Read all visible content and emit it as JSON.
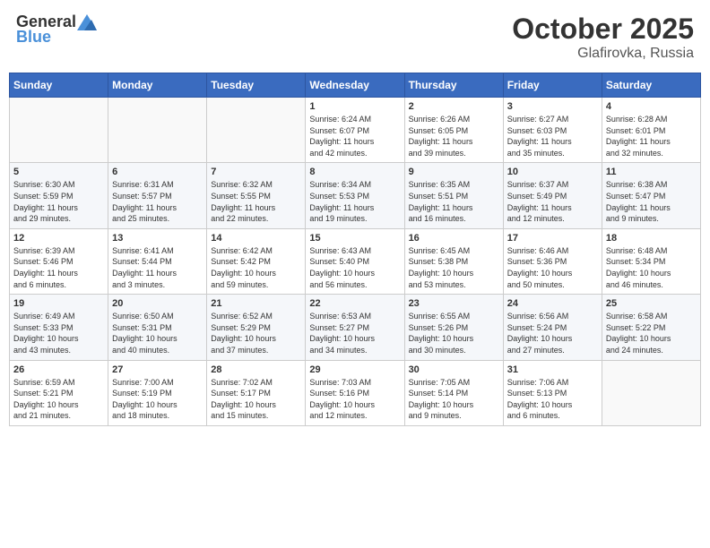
{
  "header": {
    "logo_general": "General",
    "logo_blue": "Blue",
    "month": "October 2025",
    "location": "Glafirovka, Russia"
  },
  "weekdays": [
    "Sunday",
    "Monday",
    "Tuesday",
    "Wednesday",
    "Thursday",
    "Friday",
    "Saturday"
  ],
  "weeks": [
    [
      {
        "day": "",
        "info": ""
      },
      {
        "day": "",
        "info": ""
      },
      {
        "day": "",
        "info": ""
      },
      {
        "day": "1",
        "info": "Sunrise: 6:24 AM\nSunset: 6:07 PM\nDaylight: 11 hours\nand 42 minutes."
      },
      {
        "day": "2",
        "info": "Sunrise: 6:26 AM\nSunset: 6:05 PM\nDaylight: 11 hours\nand 39 minutes."
      },
      {
        "day": "3",
        "info": "Sunrise: 6:27 AM\nSunset: 6:03 PM\nDaylight: 11 hours\nand 35 minutes."
      },
      {
        "day": "4",
        "info": "Sunrise: 6:28 AM\nSunset: 6:01 PM\nDaylight: 11 hours\nand 32 minutes."
      }
    ],
    [
      {
        "day": "5",
        "info": "Sunrise: 6:30 AM\nSunset: 5:59 PM\nDaylight: 11 hours\nand 29 minutes."
      },
      {
        "day": "6",
        "info": "Sunrise: 6:31 AM\nSunset: 5:57 PM\nDaylight: 11 hours\nand 25 minutes."
      },
      {
        "day": "7",
        "info": "Sunrise: 6:32 AM\nSunset: 5:55 PM\nDaylight: 11 hours\nand 22 minutes."
      },
      {
        "day": "8",
        "info": "Sunrise: 6:34 AM\nSunset: 5:53 PM\nDaylight: 11 hours\nand 19 minutes."
      },
      {
        "day": "9",
        "info": "Sunrise: 6:35 AM\nSunset: 5:51 PM\nDaylight: 11 hours\nand 16 minutes."
      },
      {
        "day": "10",
        "info": "Sunrise: 6:37 AM\nSunset: 5:49 PM\nDaylight: 11 hours\nand 12 minutes."
      },
      {
        "day": "11",
        "info": "Sunrise: 6:38 AM\nSunset: 5:47 PM\nDaylight: 11 hours\nand 9 minutes."
      }
    ],
    [
      {
        "day": "12",
        "info": "Sunrise: 6:39 AM\nSunset: 5:46 PM\nDaylight: 11 hours\nand 6 minutes."
      },
      {
        "day": "13",
        "info": "Sunrise: 6:41 AM\nSunset: 5:44 PM\nDaylight: 11 hours\nand 3 minutes."
      },
      {
        "day": "14",
        "info": "Sunrise: 6:42 AM\nSunset: 5:42 PM\nDaylight: 10 hours\nand 59 minutes."
      },
      {
        "day": "15",
        "info": "Sunrise: 6:43 AM\nSunset: 5:40 PM\nDaylight: 10 hours\nand 56 minutes."
      },
      {
        "day": "16",
        "info": "Sunrise: 6:45 AM\nSunset: 5:38 PM\nDaylight: 10 hours\nand 53 minutes."
      },
      {
        "day": "17",
        "info": "Sunrise: 6:46 AM\nSunset: 5:36 PM\nDaylight: 10 hours\nand 50 minutes."
      },
      {
        "day": "18",
        "info": "Sunrise: 6:48 AM\nSunset: 5:34 PM\nDaylight: 10 hours\nand 46 minutes."
      }
    ],
    [
      {
        "day": "19",
        "info": "Sunrise: 6:49 AM\nSunset: 5:33 PM\nDaylight: 10 hours\nand 43 minutes."
      },
      {
        "day": "20",
        "info": "Sunrise: 6:50 AM\nSunset: 5:31 PM\nDaylight: 10 hours\nand 40 minutes."
      },
      {
        "day": "21",
        "info": "Sunrise: 6:52 AM\nSunset: 5:29 PM\nDaylight: 10 hours\nand 37 minutes."
      },
      {
        "day": "22",
        "info": "Sunrise: 6:53 AM\nSunset: 5:27 PM\nDaylight: 10 hours\nand 34 minutes."
      },
      {
        "day": "23",
        "info": "Sunrise: 6:55 AM\nSunset: 5:26 PM\nDaylight: 10 hours\nand 30 minutes."
      },
      {
        "day": "24",
        "info": "Sunrise: 6:56 AM\nSunset: 5:24 PM\nDaylight: 10 hours\nand 27 minutes."
      },
      {
        "day": "25",
        "info": "Sunrise: 6:58 AM\nSunset: 5:22 PM\nDaylight: 10 hours\nand 24 minutes."
      }
    ],
    [
      {
        "day": "26",
        "info": "Sunrise: 6:59 AM\nSunset: 5:21 PM\nDaylight: 10 hours\nand 21 minutes."
      },
      {
        "day": "27",
        "info": "Sunrise: 7:00 AM\nSunset: 5:19 PM\nDaylight: 10 hours\nand 18 minutes."
      },
      {
        "day": "28",
        "info": "Sunrise: 7:02 AM\nSunset: 5:17 PM\nDaylight: 10 hours\nand 15 minutes."
      },
      {
        "day": "29",
        "info": "Sunrise: 7:03 AM\nSunset: 5:16 PM\nDaylight: 10 hours\nand 12 minutes."
      },
      {
        "day": "30",
        "info": "Sunrise: 7:05 AM\nSunset: 5:14 PM\nDaylight: 10 hours\nand 9 minutes."
      },
      {
        "day": "31",
        "info": "Sunrise: 7:06 AM\nSunset: 5:13 PM\nDaylight: 10 hours\nand 6 minutes."
      },
      {
        "day": "",
        "info": ""
      }
    ]
  ]
}
